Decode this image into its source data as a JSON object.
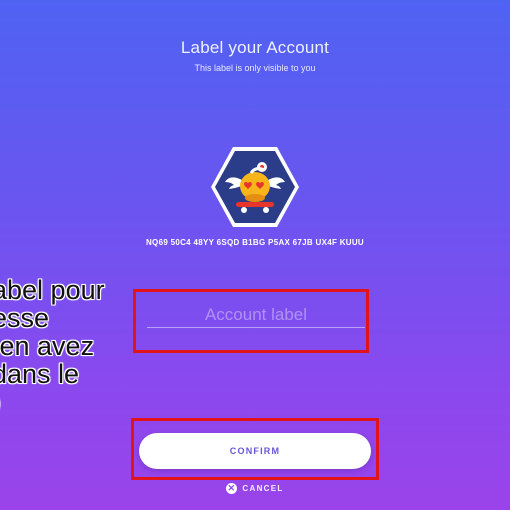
{
  "header": {
    "title": "Label your Account",
    "subtitle": "This label is only visible to you"
  },
  "account": {
    "avatar_icon": "robot-on-skateboard-avatar",
    "address": "NQ69 50C4 48YY 6SQD B1BG P5AX 67JB UX4F KUUU"
  },
  "form": {
    "label_value": "",
    "label_placeholder": "Account label"
  },
  "actions": {
    "confirm_label": "CONFIRM",
    "cancel_label": "CANCEL",
    "cancel_icon": "close-circle-icon"
  },
  "overlay": {
    "caption_lines": [
      "abel pour",
      "esse",
      " en avez",
      "dans le",
      ")"
    ]
  },
  "colors": {
    "background_top": "#4f63f3",
    "background_bottom": "#9a43ea",
    "highlight_box": "#e0141a",
    "button_text": "#6757d8"
  }
}
